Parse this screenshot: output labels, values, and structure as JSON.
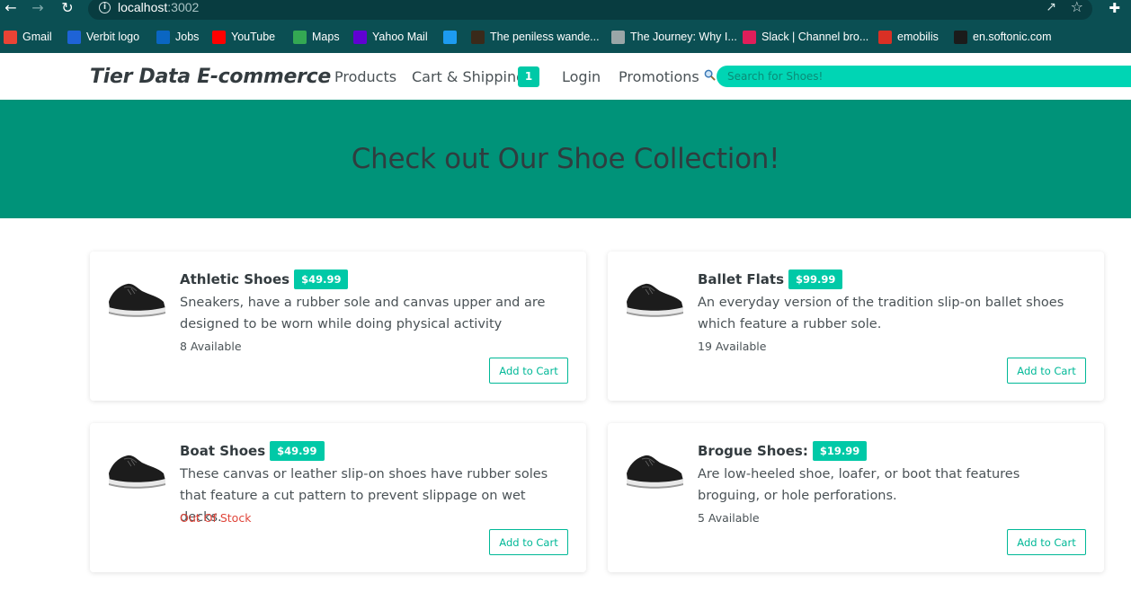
{
  "browser": {
    "url_host": "localhost",
    "url_port": ":3002",
    "bookmarks": [
      {
        "label": "Gmail",
        "icon": "gmail-icon",
        "color": "#ea4335"
      },
      {
        "label": "Verbit logo",
        "icon": "verbit-icon",
        "color": "#1e63d6"
      },
      {
        "label": "Jobs",
        "icon": "linkedin-icon",
        "color": "#0a66c2"
      },
      {
        "label": "YouTube",
        "icon": "youtube-icon",
        "color": "#ff0000"
      },
      {
        "label": "Maps",
        "icon": "maps-icon",
        "color": "#34a853"
      },
      {
        "label": "Yahoo Mail",
        "icon": "yahoo-mail-icon",
        "color": "#6001d2"
      },
      {
        "label": "",
        "icon": "twitter-icon",
        "color": "#1d9bf0"
      },
      {
        "label": "The peniless wande...",
        "icon": "page-thumbnail-icon",
        "color": "#3a2a1a"
      },
      {
        "label": "The Journey: Why I...",
        "icon": "globe-icon",
        "color": "#9aa6a7"
      },
      {
        "label": "Slack | Channel bro...",
        "icon": "slack-icon",
        "color": "#e01e5a"
      },
      {
        "label": "emobilis",
        "icon": "emobilis-icon",
        "color": "#d93025"
      },
      {
        "label": "en.softonic.com",
        "icon": "photoshop-icon",
        "color": "#1b1b1b"
      }
    ]
  },
  "navbar": {
    "brand": "Tier Data E-commerce",
    "links": {
      "products": "Products",
      "cart": "Cart & Shipping",
      "login": "Login",
      "promotions": "Promotions"
    },
    "cart_count": "1",
    "search_placeholder": "Search for Shoes!"
  },
  "hero": {
    "title": "Check out Our Shoe Collection!"
  },
  "products": [
    {
      "name": "Athletic Shoes",
      "price": "$49.99",
      "description": "Sneakers, have a rubber sole and canvas upper and are designed to be worn while doing physical activity",
      "stock": "8 Available",
      "in_stock": true,
      "button": "Add to Cart"
    },
    {
      "name": "Ballet Flats",
      "price": "$99.99",
      "description": "An everyday version of the tradition slip-on ballet shoes which feature a rubber sole.",
      "stock": "19 Available",
      "in_stock": true,
      "button": "Add to Cart"
    },
    {
      "name": "Boat Shoes",
      "price": "$49.99",
      "description": "These canvas or leather slip-on shoes have rubber soles that feature a cut pattern to prevent slippage on wet decks.",
      "stock": "Out Of Stock",
      "in_stock": false,
      "button": "Add to Cart"
    },
    {
      "name": "Brogue Shoes:",
      "price": "$19.99",
      "description": "Are low-heeled shoe, loafer, or boot that features broguing, or hole perforations.",
      "stock": "5 Available",
      "in_stock": true,
      "button": "Add to Cart"
    }
  ],
  "colors": {
    "accent": "#00c9a7",
    "hero_bg": "#009379",
    "out_of_stock": "#e0453a",
    "chrome": "#0b4f53"
  }
}
